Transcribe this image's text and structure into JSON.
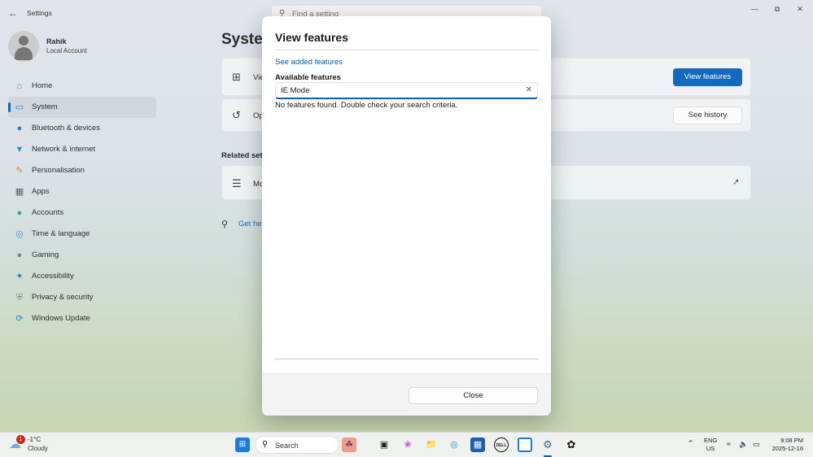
{
  "window": {
    "app_title": "Settings",
    "search_placeholder": "Find a setting"
  },
  "profile": {
    "name": "Rahik",
    "account_type": "Local Account"
  },
  "nav": {
    "items": [
      {
        "label": "Home",
        "icon": "home-icon"
      },
      {
        "label": "System",
        "icon": "system-icon"
      },
      {
        "label": "Bluetooth & devices",
        "icon": "bluetooth-icon"
      },
      {
        "label": "Network & internet",
        "icon": "wifi-icon"
      },
      {
        "label": "Personalisation",
        "icon": "brush-icon"
      },
      {
        "label": "Apps",
        "icon": "apps-icon"
      },
      {
        "label": "Accounts",
        "icon": "accounts-icon"
      },
      {
        "label": "Time & language",
        "icon": "globe-icon"
      },
      {
        "label": "Gaming",
        "icon": "gamepad-icon"
      },
      {
        "label": "Accessibility",
        "icon": "accessibility-icon"
      },
      {
        "label": "Privacy & security",
        "icon": "shield-icon"
      },
      {
        "label": "Windows Update",
        "icon": "update-icon"
      }
    ],
    "active": "System"
  },
  "main": {
    "page_title": "Syster",
    "card1_text": "Vie",
    "card2_text": "Op",
    "card3_text": "Mc",
    "view_features_button": "View features",
    "see_history_button": "See history",
    "related_settings": "Related setti",
    "get_help": "Get hel"
  },
  "dialog": {
    "title": "View features",
    "see_added_link": "See added features",
    "available_label": "Available features",
    "search_value": "IE Mode",
    "no_results": "No features found. Double check your search criteria.",
    "close_button": "Close"
  },
  "taskbar": {
    "weather_badge": "1",
    "temperature": "-1°C",
    "condition": "Cloudy",
    "search_label": "Search",
    "language_line1": "ENG",
    "language_line2": "US",
    "time": "9:08 PM",
    "date": "2025-12-16"
  },
  "colors": {
    "accent": "#005fb8",
    "badge": "#c42b1c"
  }
}
